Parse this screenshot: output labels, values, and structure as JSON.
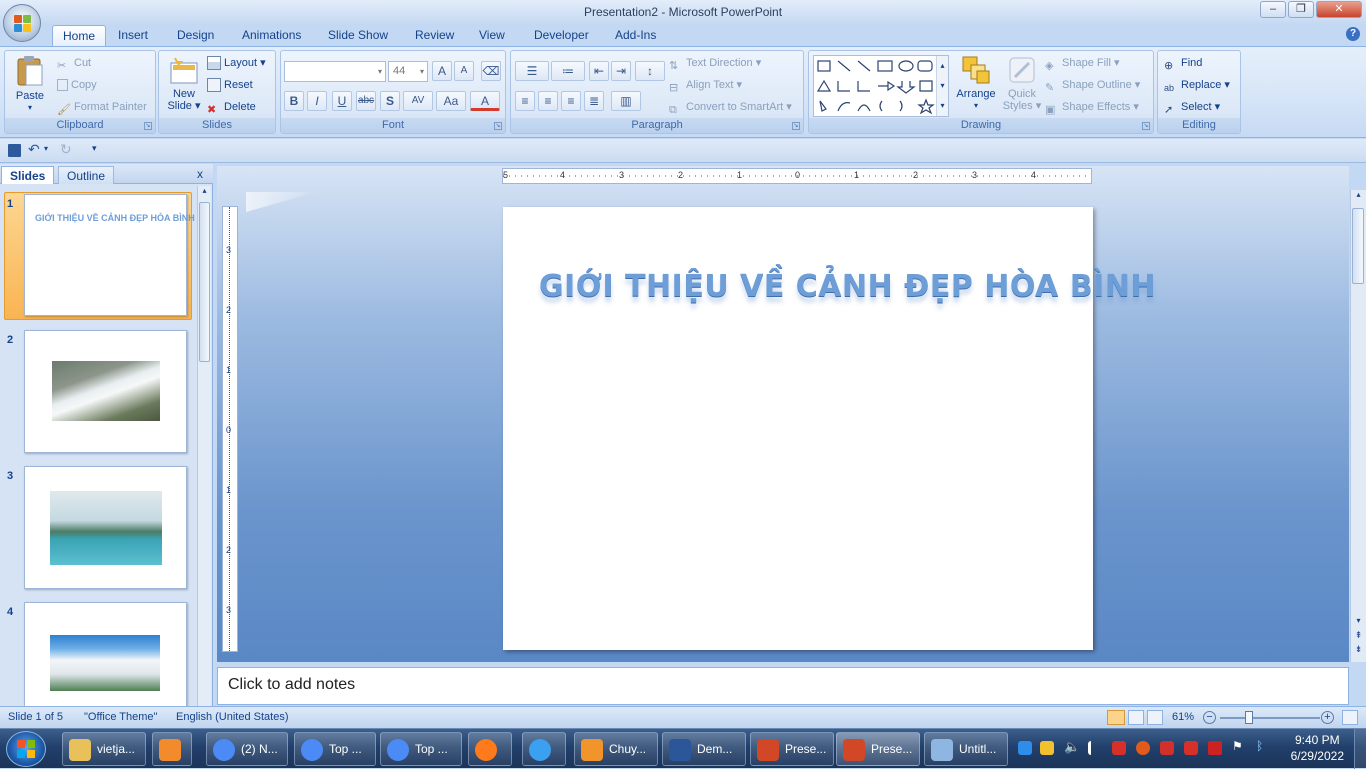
{
  "window": {
    "title": "Presentation2 - Microsoft PowerPoint",
    "controls": {
      "minimize": "–",
      "restore": "❐",
      "close": "✕"
    }
  },
  "tabs": [
    "Home",
    "Insert",
    "Design",
    "Animations",
    "Slide Show",
    "Review",
    "View",
    "Developer",
    "Add-Ins"
  ],
  "active_tab": "Home",
  "ribbon": {
    "clipboard": {
      "label": "Clipboard",
      "paste": "Paste",
      "cut": "Cut",
      "copy": "Copy",
      "format_painter": "Format Painter"
    },
    "slides": {
      "label": "Slides",
      "new_slide": "New",
      "new_slide_2": "Slide",
      "layout": "Layout",
      "reset": "Reset",
      "delete": "Delete"
    },
    "font": {
      "label": "Font",
      "font_name": "",
      "font_size": "44",
      "bold": "B",
      "italic": "I",
      "underline": "U",
      "strike": "abc",
      "shadow": "S",
      "spacing": "AV",
      "case": "Aa",
      "grow": "A",
      "shrink": "A",
      "color": "A"
    },
    "paragraph": {
      "label": "Paragraph",
      "text_direction": "Text Direction",
      "align_text": "Align Text",
      "convert_smartart": "Convert to SmartArt"
    },
    "drawing": {
      "label": "Drawing",
      "arrange": "Arrange",
      "quick_styles": "Quick",
      "quick_styles_2": "Styles",
      "shape_fill": "Shape Fill",
      "shape_outline": "Shape Outline",
      "shape_effects": "Shape Effects"
    },
    "editing": {
      "label": "Editing",
      "find": "Find",
      "replace": "Replace",
      "select": "Select"
    }
  },
  "slides_panel": {
    "tab_slides": "Slides",
    "tab_outline": "Outline",
    "close": "x",
    "thumbnails": [
      {
        "number": "1",
        "title": "GIỚI THIỆU VỀ CẢNH ĐẸP HÒA BÌNH"
      },
      {
        "number": "2",
        "title": ""
      },
      {
        "number": "3",
        "title": ""
      },
      {
        "number": "4",
        "title": ""
      }
    ]
  },
  "rulers": {
    "h_ticks": [
      "5",
      "4",
      "3",
      "2",
      "1",
      "0",
      "1",
      "2",
      "3",
      "4"
    ],
    "v_ticks": [
      "3",
      "2",
      "1",
      "0",
      "1",
      "2",
      "3"
    ]
  },
  "slide": {
    "title": "GIỚI THIỆU VỀ CẢNH ĐẸP HÒA BÌNH"
  },
  "notes": {
    "placeholder": "Click to add notes"
  },
  "status": {
    "slide_of": "Slide 1 of 5",
    "theme": "\"Office Theme\"",
    "language": "English (United States)",
    "zoom": "61%"
  },
  "taskbar": {
    "items": [
      {
        "label": "vietja...",
        "color": "#e8c15a"
      },
      {
        "label": "",
        "color": "#f28b2c"
      },
      {
        "label": "(2) N...",
        "color": "#4c8bf5"
      },
      {
        "label": "Top ...",
        "color": "#4c8bf5"
      },
      {
        "label": "Top ...",
        "color": "#4c8bf5"
      },
      {
        "label": "",
        "color": "#ff7a1a"
      },
      {
        "label": "",
        "color": "#3aa0ef"
      },
      {
        "label": "Chuy...",
        "color": "#f2942c"
      },
      {
        "label": "Dem...",
        "color": "#2b579a"
      },
      {
        "label": "Prese...",
        "color": "#d24726"
      },
      {
        "label": "Prese...",
        "color": "#d24726"
      },
      {
        "label": "Untitl...",
        "color": "#8fb6e0"
      }
    ],
    "time": "9:40 PM",
    "date": "6/29/2022"
  }
}
